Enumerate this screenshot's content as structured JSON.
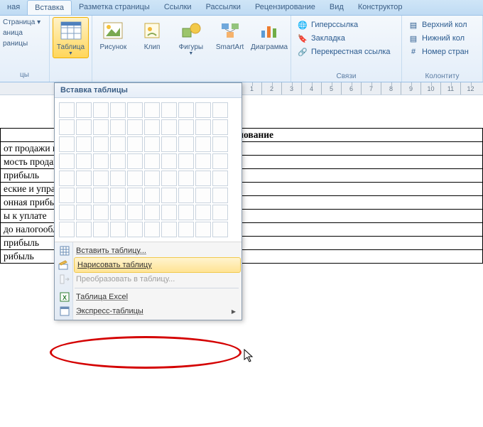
{
  "ribbon": {
    "tabs": [
      "ная",
      "Вставка",
      "Разметка страницы",
      "Ссылки",
      "Рассылки",
      "Рецензирование",
      "Вид",
      "Конструктор"
    ],
    "active_tab_index": 1,
    "left_stub_items": [
      "Страница ▾",
      "аница",
      "раницы"
    ],
    "left_stub_label": "цы",
    "table_btn": "Таблица",
    "illustr": {
      "pic": "Рисунок",
      "clip": "Клип",
      "shapes": "Фигуры",
      "smartart": "SmartArt",
      "chart": "Диаграмма"
    },
    "links": {
      "hyper": "Гиперссылка",
      "bookmark": "Закладка",
      "crossref": "Перекрестная ссылка",
      "label": "Связи"
    },
    "headfoot": {
      "header": "Верхний кол",
      "footer": "Нижний кол",
      "pagenum": "Номер стран",
      "label": "Колонтиту"
    }
  },
  "dropdown": {
    "title": "Вставка таблицы",
    "insert": "Вставить таблицу...",
    "draw": "Нарисовать таблицу",
    "convert": "Преобразовать в таблицу...",
    "excel": "Таблица Excel",
    "express": "Экспресс-таблицы"
  },
  "doc_table": {
    "header": "Наименование",
    "rows": [
      "от продажи продукции",
      "мость проданной  продукции",
      "прибыль",
      "еские и управленческие расходы",
      "онная прибыль",
      "ы к уплате",
      "до налогообложения",
      "прибыль",
      "рибыль"
    ]
  },
  "ruler_ticks": [
    "1",
    "2",
    "3",
    "4",
    "5",
    "6",
    "7",
    "8",
    "9",
    "10",
    "11",
    "12"
  ]
}
